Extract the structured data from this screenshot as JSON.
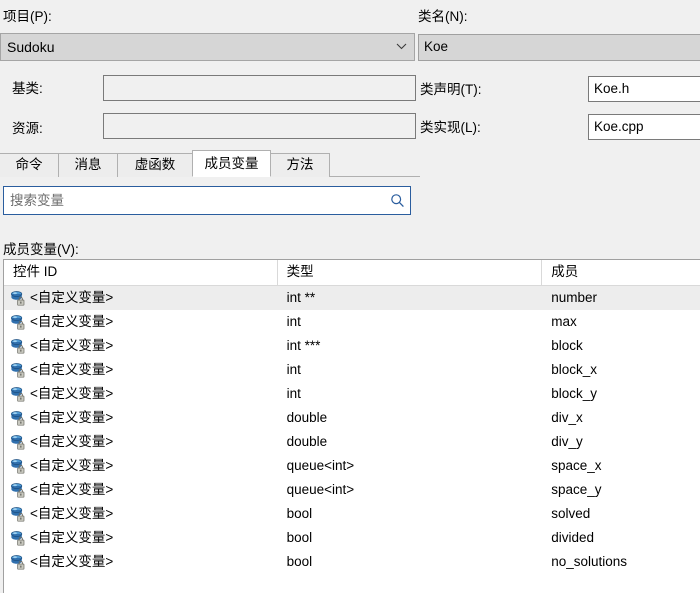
{
  "form": {
    "project_label": "项目(P):",
    "project_value": "Sudoku",
    "class_name_label": "类名(N):",
    "class_name_value": "Koe",
    "base_class_label": "基类:",
    "base_class_value": "",
    "resource_label": "资源:",
    "resource_value": "",
    "class_decl_label": "类声明(T):",
    "class_decl_value": "Koe.h",
    "class_impl_label": "类实现(L):",
    "class_impl_value": "Koe.cpp"
  },
  "tabs": [
    {
      "label": "命令",
      "selected": false
    },
    {
      "label": "消息",
      "selected": false
    },
    {
      "label": "虚函数",
      "selected": false
    },
    {
      "label": "成员变量",
      "selected": true
    },
    {
      "label": "方法",
      "selected": false
    }
  ],
  "search": {
    "placeholder": "搜索变量",
    "value": "",
    "icon": "search-icon"
  },
  "list": {
    "label": "成员变量(V):",
    "columns": [
      "控件 ID",
      "类型",
      "成员"
    ],
    "row_icon": "variable-locked-icon",
    "rows": [
      {
        "id": "<自定义变量>",
        "type": "int **",
        "member": "number",
        "selected": true
      },
      {
        "id": "<自定义变量>",
        "type": "int",
        "member": "max",
        "selected": false
      },
      {
        "id": "<自定义变量>",
        "type": "int ***",
        "member": "block",
        "selected": false
      },
      {
        "id": "<自定义变量>",
        "type": "int",
        "member": "block_x",
        "selected": false
      },
      {
        "id": "<自定义变量>",
        "type": "int",
        "member": "block_y",
        "selected": false
      },
      {
        "id": "<自定义变量>",
        "type": "double",
        "member": "div_x",
        "selected": false
      },
      {
        "id": "<自定义变量>",
        "type": "double",
        "member": "div_y",
        "selected": false
      },
      {
        "id": "<自定义变量>",
        "type": "queue<int>",
        "member": "space_x",
        "selected": false
      },
      {
        "id": "<自定义变量>",
        "type": "queue<int>",
        "member": "space_y",
        "selected": false
      },
      {
        "id": "<自定义变量>",
        "type": "bool",
        "member": "solved",
        "selected": false
      },
      {
        "id": "<自定义变量>",
        "type": "bool",
        "member": "divided",
        "selected": false
      },
      {
        "id": "<自定义变量>",
        "type": "bool",
        "member": "no_solutions",
        "selected": false
      }
    ]
  },
  "colors": {
    "dialog_bg": "#f0f0f0",
    "field_bg": "#ffffff",
    "disabled_bg": "#d6d6d6",
    "search_border": "#2a5d9e",
    "row_selected_bg": "#ededed",
    "icon_blue": "#2f6fad"
  }
}
